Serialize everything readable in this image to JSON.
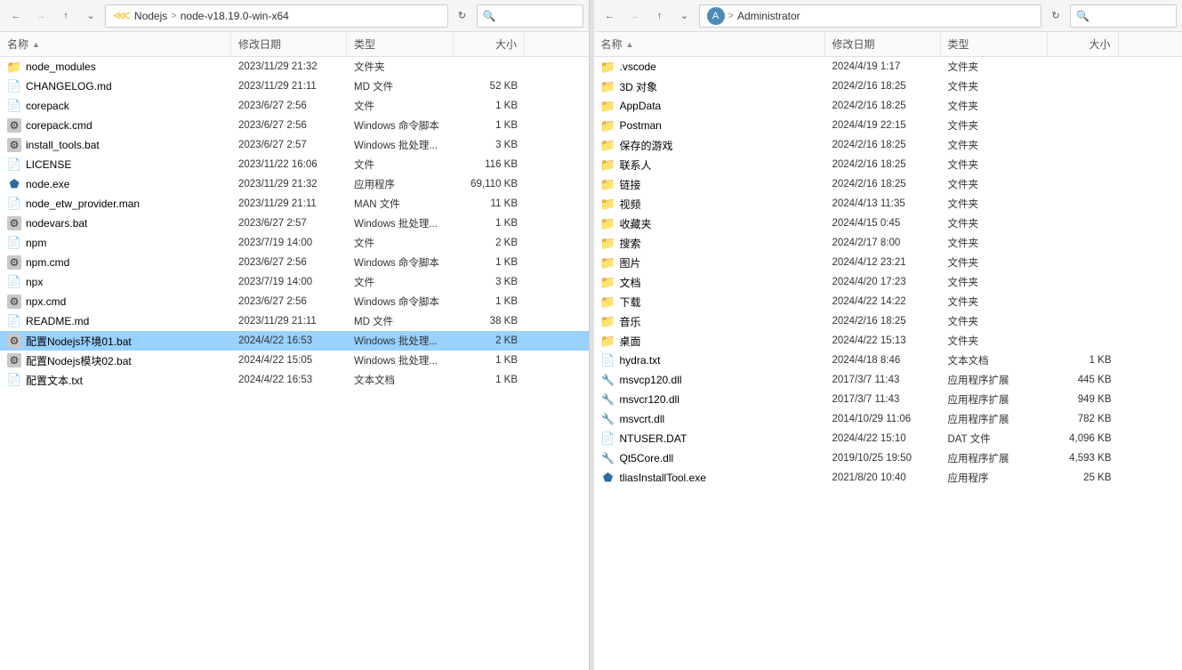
{
  "pane1": {
    "nav": {
      "back_disabled": false,
      "forward_disabled": false,
      "up_disabled": false,
      "path_parts": [
        "«",
        "Nodejs",
        ">",
        "node-v18.19.0-win-x64"
      ],
      "search_placeholder": "搜索"
    },
    "columns": {
      "name": "名称",
      "date": "修改日期",
      "type": "类型",
      "size": "大小",
      "sort_arrow": "▲"
    },
    "files": [
      {
        "id": 1,
        "icon": "folder",
        "name": "node_modules",
        "date": "2023/11/29 21:32",
        "type": "文件夹",
        "size": ""
      },
      {
        "id": 2,
        "icon": "txt",
        "name": "CHANGELOG.md",
        "date": "2023/11/29 21:11",
        "type": "MD 文件",
        "size": "52 KB"
      },
      {
        "id": 3,
        "icon": "file",
        "name": "corepack",
        "date": "2023/6/27 2:56",
        "type": "文件",
        "size": "1 KB"
      },
      {
        "id": 4,
        "icon": "bat",
        "name": "corepack.cmd",
        "date": "2023/6/27 2:56",
        "type": "Windows 命令脚本",
        "size": "1 KB"
      },
      {
        "id": 5,
        "icon": "bat",
        "name": "install_tools.bat",
        "date": "2023/6/27 2:57",
        "type": "Windows 批处理...",
        "size": "3 KB"
      },
      {
        "id": 6,
        "icon": "file",
        "name": "LICENSE",
        "date": "2023/11/22 16:06",
        "type": "文件",
        "size": "116 KB"
      },
      {
        "id": 7,
        "icon": "exe",
        "name": "node.exe",
        "date": "2023/11/29 21:32",
        "type": "应用程序",
        "size": "69,110 KB"
      },
      {
        "id": 8,
        "icon": "file",
        "name": "node_etw_provider.man",
        "date": "2023/11/29 21:11",
        "type": "MAN 文件",
        "size": "11 KB"
      },
      {
        "id": 9,
        "icon": "bat",
        "name": "nodevars.bat",
        "date": "2023/6/27 2:57",
        "type": "Windows 批处理...",
        "size": "1 KB"
      },
      {
        "id": 10,
        "icon": "file",
        "name": "npm",
        "date": "2023/7/19 14:00",
        "type": "文件",
        "size": "2 KB"
      },
      {
        "id": 11,
        "icon": "bat",
        "name": "npm.cmd",
        "date": "2023/6/27 2:56",
        "type": "Windows 命令脚本",
        "size": "1 KB"
      },
      {
        "id": 12,
        "icon": "file",
        "name": "npx",
        "date": "2023/7/19 14:00",
        "type": "文件",
        "size": "3 KB"
      },
      {
        "id": 13,
        "icon": "bat",
        "name": "npx.cmd",
        "date": "2023/6/27 2:56",
        "type": "Windows 命令脚本",
        "size": "1 KB"
      },
      {
        "id": 14,
        "icon": "txt",
        "name": "README.md",
        "date": "2023/11/29 21:11",
        "type": "MD 文件",
        "size": "38 KB"
      },
      {
        "id": 15,
        "icon": "bat",
        "name": "配置Nodejs环境01.bat",
        "date": "2024/4/22 16:53",
        "type": "Windows 批处理...",
        "size": "2 KB",
        "selected": true
      },
      {
        "id": 16,
        "icon": "bat",
        "name": "配置Nodejs模块02.bat",
        "date": "2024/4/22 15:05",
        "type": "Windows 批处理...",
        "size": "1 KB"
      },
      {
        "id": 17,
        "icon": "txt",
        "name": "配置文本.txt",
        "date": "2024/4/22 16:53",
        "type": "文本文档",
        "size": "1 KB"
      }
    ]
  },
  "pane2": {
    "nav": {
      "path_parts": [
        "«",
        ">",
        "Administrator"
      ],
      "has_user_icon": true
    },
    "columns": {
      "name": "名称",
      "date": "修改日期",
      "type": "类型",
      "size": "大小",
      "sort_arrow": "▲"
    },
    "files": [
      {
        "id": 1,
        "icon": "folder_vscode",
        "name": ".vscode",
        "date": "2024/4/19 1:17",
        "type": "文件夹",
        "size": ""
      },
      {
        "id": 2,
        "icon": "folder_3d",
        "name": "3D 对象",
        "date": "2024/2/16 18:25",
        "type": "文件夹",
        "size": ""
      },
      {
        "id": 3,
        "icon": "folder",
        "name": "AppData",
        "date": "2024/2/16 18:25",
        "type": "文件夹",
        "size": ""
      },
      {
        "id": 4,
        "icon": "folder_postman",
        "name": "Postman",
        "date": "2024/4/19 22:15",
        "type": "文件夹",
        "size": ""
      },
      {
        "id": 5,
        "icon": "folder_game",
        "name": "保存的游戏",
        "date": "2024/2/16 18:25",
        "type": "文件夹",
        "size": ""
      },
      {
        "id": 6,
        "icon": "folder_contacts",
        "name": "联系人",
        "date": "2024/2/16 18:25",
        "type": "文件夹",
        "size": ""
      },
      {
        "id": 7,
        "icon": "folder_link",
        "name": "链接",
        "date": "2024/2/16 18:25",
        "type": "文件夹",
        "size": ""
      },
      {
        "id": 8,
        "icon": "folder_video",
        "name": "视频",
        "date": "2024/4/13 11:35",
        "type": "文件夹",
        "size": ""
      },
      {
        "id": 9,
        "icon": "folder_fav",
        "name": "收藏夹",
        "date": "2024/4/15 0:45",
        "type": "文件夹",
        "size": ""
      },
      {
        "id": 10,
        "icon": "folder_search",
        "name": "搜索",
        "date": "2024/2/17 8:00",
        "type": "文件夹",
        "size": ""
      },
      {
        "id": 11,
        "icon": "folder_pic",
        "name": "图片",
        "date": "2024/4/12 23:21",
        "type": "文件夹",
        "size": ""
      },
      {
        "id": 12,
        "icon": "folder_doc",
        "name": "文档",
        "date": "2024/4/20 17:23",
        "type": "文件夹",
        "size": ""
      },
      {
        "id": 13,
        "icon": "folder_dl",
        "name": "下载",
        "date": "2024/4/22 14:22",
        "type": "文件夹",
        "size": ""
      },
      {
        "id": 14,
        "icon": "folder_music",
        "name": "音乐",
        "date": "2024/2/16 18:25",
        "type": "文件夹",
        "size": ""
      },
      {
        "id": 15,
        "icon": "folder_desktop",
        "name": "桌面",
        "date": "2024/4/22 15:13",
        "type": "文件夹",
        "size": ""
      },
      {
        "id": 16,
        "icon": "txt",
        "name": "hydra.txt",
        "date": "2024/4/18 8:46",
        "type": "文本文档",
        "size": "1 KB"
      },
      {
        "id": 17,
        "icon": "dll",
        "name": "msvcp120.dll",
        "date": "2017/3/7 11:43",
        "type": "应用程序扩展",
        "size": "445 KB"
      },
      {
        "id": 18,
        "icon": "dll",
        "name": "msvcr120.dll",
        "date": "2017/3/7 11:43",
        "type": "应用程序扩展",
        "size": "949 KB"
      },
      {
        "id": 19,
        "icon": "dll",
        "name": "msvcrt.dll",
        "date": "2014/10/29 11:06",
        "type": "应用程序扩展",
        "size": "782 KB"
      },
      {
        "id": 20,
        "icon": "file",
        "name": "NTUSER.DAT",
        "date": "2024/4/22 15:10",
        "type": "DAT 文件",
        "size": "4,096 KB"
      },
      {
        "id": 21,
        "icon": "dll",
        "name": "Qt5Core.dll",
        "date": "2019/10/25 19:50",
        "type": "应用程序扩展",
        "size": "4,593 KB"
      },
      {
        "id": 22,
        "icon": "exe",
        "name": "tliasInstallTool.exe",
        "date": "2021/8/20 10:40",
        "type": "应用程序",
        "size": "25 KB"
      }
    ]
  }
}
